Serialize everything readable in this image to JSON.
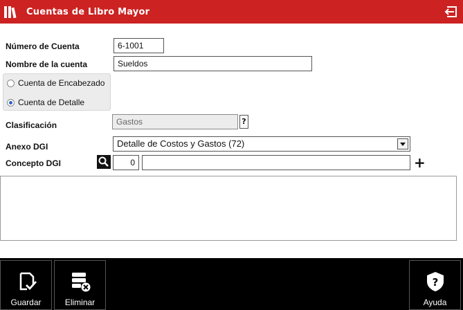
{
  "header": {
    "title": "Cuentas de Libro Mayor",
    "app_icon": "books-icon",
    "back_icon": "back-arrow-icon"
  },
  "form": {
    "account_number_label": "Número de Cuenta",
    "account_number_value": "6-1001",
    "account_name_label": "Nombre de la cuenta",
    "account_name_value": "Sueldos",
    "radio_header_label": "Cuenta de Encabezado",
    "radio_detail_label": "Cuenta de Detalle",
    "selected_radio": "detail",
    "classification_label": "Clasificación",
    "classification_value": "Gastos",
    "help_mark": "?",
    "annex_label": "Anexo DGI",
    "annex_value": "Detalle de Costos y Gastos  (72)",
    "concept_label": "Concepto DGI",
    "concept_code": "0",
    "concept_description": "",
    "notes": ""
  },
  "toolbar": {
    "save_label": "Guardar",
    "delete_label": "Eliminar",
    "help_label": "Ayuda"
  },
  "colors": {
    "header_bg": "#cc2222",
    "toolbar_bg": "#000000",
    "radio_selected": "#2a63c8"
  }
}
